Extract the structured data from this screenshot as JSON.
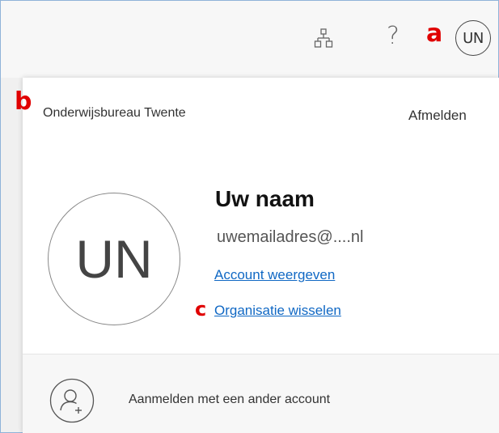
{
  "header": {
    "org_icon": "organization-tree-icon",
    "help_icon": "question-mark-icon",
    "help_glyph": "?",
    "avatar_initials": "UN"
  },
  "annotations": {
    "a": "a",
    "b": "b",
    "c": "c"
  },
  "account_panel": {
    "organization_name": "Onderwijsbureau Twente",
    "sign_out_label": "Afmelden",
    "avatar_initials": "UN",
    "user_name": "Uw naam",
    "user_email": "uwemailadres@....nl",
    "view_account_link": "Account weergeven",
    "switch_organization_link": "Organisatie wisselen",
    "add_account_icon": "add-person-icon",
    "add_account_label": "Aanmelden met een ander account"
  },
  "colors": {
    "link": "#1068c4",
    "annotation": "#e00000"
  }
}
